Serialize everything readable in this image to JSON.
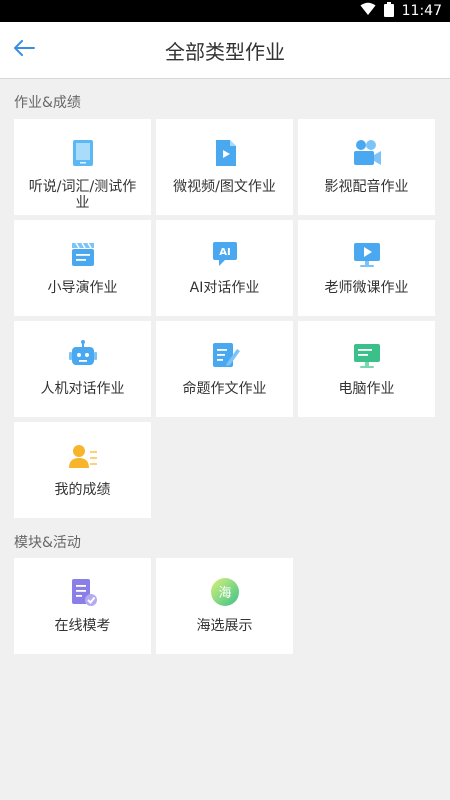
{
  "status_bar": {
    "time": "11:47"
  },
  "header": {
    "title": "全部类型作业"
  },
  "sections": [
    {
      "label": "作业&成绩",
      "items": [
        {
          "label": "听说/词汇/测试作业",
          "icon": "tablet-icon"
        },
        {
          "label": "微视频/图文作业",
          "icon": "video-file-icon"
        },
        {
          "label": "影视配音作业",
          "icon": "video-camera-icon"
        },
        {
          "label": "小导演作业",
          "icon": "clapperboard-icon"
        },
        {
          "label": "AI对话作业",
          "icon": "ai-chat-icon"
        },
        {
          "label": "老师微课作业",
          "icon": "play-monitor-icon"
        },
        {
          "label": "人机对话作业",
          "icon": "robot-icon"
        },
        {
          "label": "命题作文作业",
          "icon": "edit-note-icon"
        },
        {
          "label": "电脑作业",
          "icon": "computer-icon"
        },
        {
          "label": "我的成绩",
          "icon": "user-list-icon"
        }
      ]
    },
    {
      "label": "模块&活动",
      "items": [
        {
          "label": "在线模考",
          "icon": "exam-paper-icon"
        },
        {
          "label": "海选展示",
          "icon": "audition-badge-icon",
          "badge_text": "海"
        }
      ]
    }
  ]
}
